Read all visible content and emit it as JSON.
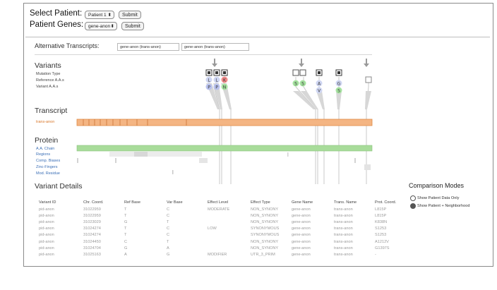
{
  "patient": {
    "select_label": "Select Patient:",
    "selected": "Patient 1",
    "submit": "Submit",
    "genes_label": "Patient Genes:",
    "genes_selected": "gene-anon",
    "genes_submit": "Submit"
  },
  "alt_transcripts": {
    "label": "Alternative Transcripts:",
    "items": [
      "gene-anon (trans-anon)",
      "gene-anon (trans-anon)"
    ]
  },
  "variants": {
    "title": "Variants",
    "rows": [
      "Mutation Type",
      "Reference A.A.s",
      "Variant A.A.s"
    ]
  },
  "transcript": {
    "title": "Transcript",
    "name": "trans-anon"
  },
  "protein": {
    "title": "Protein",
    "rows": [
      "A.A. Chain",
      "Regions",
      "Comp. Biases",
      "Zinc-Fingers",
      "Mod. Residue"
    ]
  },
  "details": {
    "title": "Variant Details",
    "columns": [
      "Variant ID",
      "Chr. Coord.",
      "Ref Base",
      "Var Base",
      "Effect Level",
      "Effect Type",
      "Gene Name",
      "Trans. Name",
      "Prot. Coord."
    ],
    "rows": [
      [
        "pid-anon",
        "31022959",
        "T",
        "C",
        "MODERATE",
        "NON_SYNONY",
        "gene-anon",
        "trans-anon",
        "L815P"
      ],
      [
        "pid-anon",
        "31022959",
        "T",
        "C",
        "",
        "NON_SYNONY",
        "gene-anon",
        "trans-anon",
        "L815P"
      ],
      [
        "pid-anon",
        "31023029",
        "G",
        "T",
        "",
        "NON_SYNONY",
        "gene-anon",
        "trans-anon",
        "K838N"
      ],
      [
        "pid-anon",
        "31024274",
        "T",
        "C",
        "LOW",
        "SYNONYMOUS",
        "gene-anon",
        "trans-anon",
        "S1253"
      ],
      [
        "pid-anon",
        "31024274",
        "T",
        "C",
        "",
        "SYNONYMOUS",
        "gene-anon",
        "trans-anon",
        "S1253"
      ],
      [
        "pid-anon",
        "31024450",
        "C",
        "T",
        "",
        "NON_SYNONY",
        "gene-anon",
        "trans-anon",
        "A1212V"
      ],
      [
        "pid-anon",
        "31024704",
        "G",
        "A",
        "",
        "NON_SYNONY",
        "gene-anon",
        "trans-anon",
        "G1397S"
      ],
      [
        "pid-anon",
        "31025163",
        "A",
        "G",
        "MODIFIER",
        "UTR_3_PRIM",
        "gene-anon",
        "trans-anon",
        "-"
      ]
    ]
  },
  "comparison": {
    "title": "Comparison Modes",
    "options": [
      "Show Patient Data Only",
      "Show Patient + Neighborhood"
    ],
    "selected_index": 1
  },
  "colors": {
    "transcript_fill": "#f4b583",
    "transcript_border": "#e08a45",
    "chain_fill": "#a8dc9a",
    "gray_connector": "#c2c2c2"
  }
}
